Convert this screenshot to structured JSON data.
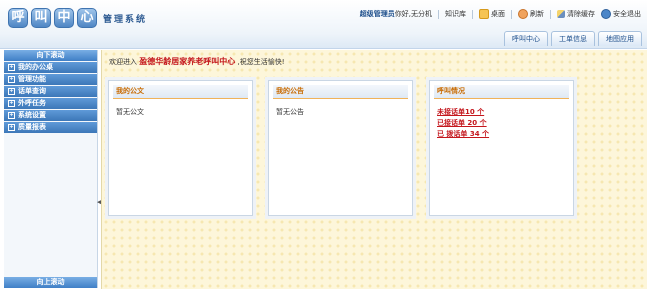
{
  "header": {
    "logo_big": [
      "呼",
      "叫",
      "中",
      "心"
    ],
    "logo_small": "管理系统",
    "user_name": "超级管理员",
    "user_greeting": "你好,无分机",
    "links": {
      "knowledge": "知识库",
      "desktop": "桌面",
      "refresh": "刷新",
      "clear_cache": "清除缓存",
      "logout": "安全退出"
    },
    "tabs": [
      "呼叫中心",
      "工单信息",
      "地图应用"
    ]
  },
  "sidebar": {
    "scroll_down": "向下滚动",
    "scroll_up": "向上滚动",
    "items": [
      "我的办公桌",
      "管理功能",
      "话单查询",
      "外呼任务",
      "系统设置",
      "质量报表"
    ]
  },
  "main": {
    "greeting_prefix": "欢迎进入",
    "org_name": "盈德华龄居家养老呼叫中心",
    "greeting_suffix": ",祝您生活愉快!",
    "panels": {
      "documents": {
        "title": "我的公文",
        "empty": "暂无公文"
      },
      "notices": {
        "title": "我的公告",
        "empty": "暂无公告"
      },
      "calls": {
        "title": "呼叫情况",
        "unreceived": "未接话单10 个",
        "received": "已接话单 20 个",
        "dialed": "已 拨话单 34 个"
      }
    }
  }
}
